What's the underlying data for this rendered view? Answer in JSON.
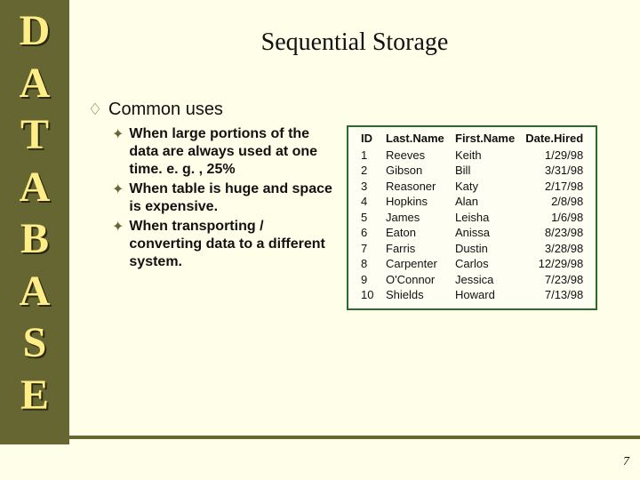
{
  "sidebar": {
    "letters": [
      "D",
      "A",
      "T",
      "A",
      "B",
      "A",
      "S",
      "E"
    ]
  },
  "title": "Sequential Storage",
  "heading": "Common uses",
  "bullets": [
    "When large portions of the data are always used at one time.  e. g. , 25%",
    "When table is huge and space is expensive.",
    "When transporting / converting data to a different system."
  ],
  "table": {
    "headers": [
      "ID",
      "Last.Name",
      "First.Name",
      "Date.Hired"
    ],
    "rows": [
      [
        "1",
        "Reeves",
        "Keith",
        "1/29/98"
      ],
      [
        "2",
        "Gibson",
        "Bill",
        "3/31/98"
      ],
      [
        "3",
        "Reasoner",
        "Katy",
        "2/17/98"
      ],
      [
        "4",
        "Hopkins",
        "Alan",
        "2/8/98"
      ],
      [
        "5",
        "James",
        "Leisha",
        "1/6/98"
      ],
      [
        "6",
        "Eaton",
        "Anissa",
        "8/23/98"
      ],
      [
        "7",
        "Farris",
        "Dustin",
        "3/28/98"
      ],
      [
        "8",
        "Carpenter",
        "Carlos",
        "12/29/98"
      ],
      [
        "9",
        "O'Connor",
        "Jessica",
        "7/23/98"
      ],
      [
        "10",
        "Shields",
        "Howard",
        "7/13/98"
      ]
    ]
  },
  "page_number": "7"
}
